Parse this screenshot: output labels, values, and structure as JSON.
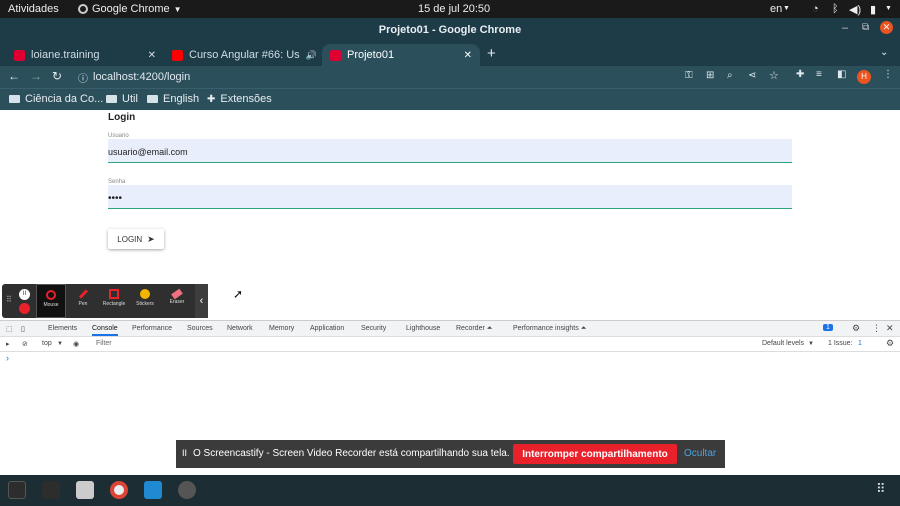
{
  "gnome": {
    "activities": "Atividades",
    "app_name": "Google Chrome",
    "datetime": "15 de jul  20:50",
    "lang": "en"
  },
  "window": {
    "title": "Projeto01 - Google Chrome"
  },
  "tabs": [
    {
      "title": "loiane.training",
      "favicon_color": "#dd0031"
    },
    {
      "title": "Curso Angular #66: Us",
      "favicon_color": "#ff0000"
    },
    {
      "title": "Projeto01",
      "favicon_color": "#dd0031"
    }
  ],
  "address": {
    "url": "localhost:4200/login",
    "avatar": "H"
  },
  "bookmarks": [
    "Ciência da Co...",
    "Util",
    "English",
    "Extensões"
  ],
  "page": {
    "heading": "Login",
    "username_label": "Usuario",
    "username_value": "usuario@email.com",
    "password_label": "Senha",
    "password_value": "••••",
    "login_button": "LOGIN"
  },
  "screencastify_tools": [
    "Mouse",
    "Pen",
    "Rectangle",
    "Stickers",
    "Eraser"
  ],
  "devtools": {
    "tabs": [
      "Elements",
      "Console",
      "Performance",
      "Sources",
      "Network",
      "Memory",
      "Application",
      "Security",
      "Lighthouse",
      "Recorder ⏶",
      "Performance insights ⏶"
    ],
    "issues_badge": "1",
    "context": "top",
    "filter_placeholder": "Filter",
    "levels": "Default levels",
    "issues_text": "1 Issue:",
    "issues_count": "1",
    "prompt": "›"
  },
  "banner": {
    "pause": "II",
    "text": "O Screencastify - Screen Video Recorder está compartilhando sua tela.",
    "stop": "Interromper compartilhamento",
    "hide": "Ocultar"
  },
  "colors": {
    "accent_green": "#2aa57e",
    "chrome_dark": "#1e3b48",
    "stop_red": "#e8212b",
    "hide_blue": "#4aa3df"
  }
}
